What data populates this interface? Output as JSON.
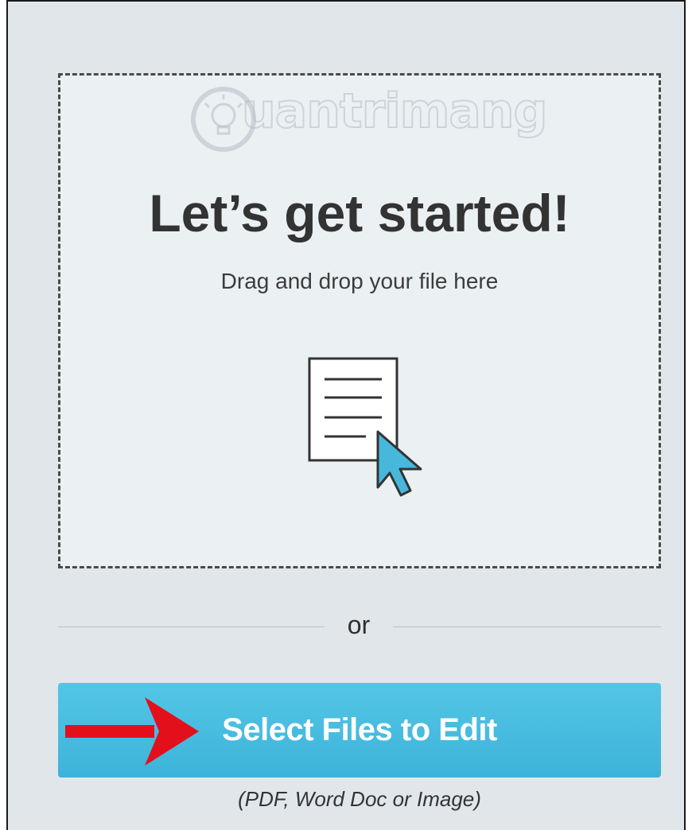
{
  "watermark": {
    "text": "uantrimang",
    "icon": "lightbulb-icon"
  },
  "dropzone": {
    "title": "Let’s get started!",
    "subtitle": "Drag and drop your file here",
    "icon": "document-cursor-icon"
  },
  "divider": {
    "label": "or"
  },
  "select_button": {
    "label": "Select Files to Edit",
    "color": "#48bde0"
  },
  "annotation": {
    "icon": "red-arrow-icon",
    "color": "#e3101b"
  },
  "hint": "(PDF, Word Doc or Image)"
}
